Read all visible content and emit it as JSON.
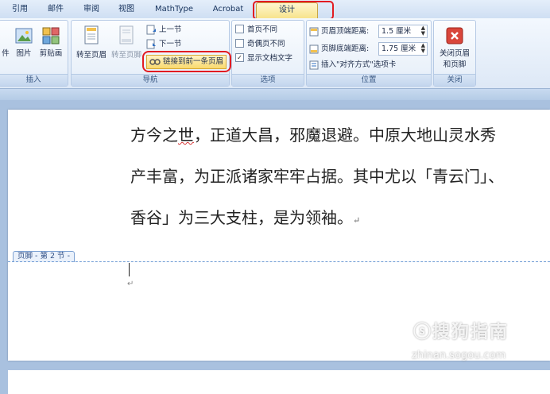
{
  "tabs": [
    {
      "label": "引用"
    },
    {
      "label": "邮件"
    },
    {
      "label": "审阅"
    },
    {
      "label": "视图"
    },
    {
      "label": "MathType"
    },
    {
      "label": "Acrobat"
    },
    {
      "label": "设计",
      "active": true
    }
  ],
  "ribbon": {
    "insert_group": {
      "name": "插入",
      "buttons": [
        "件",
        "图片",
        "剪贴画"
      ]
    },
    "nav_group": {
      "name": "导航",
      "goto_header": "转至页眉",
      "goto_footer": "转至页脚",
      "prev_section": "上一节",
      "next_section": "下一节",
      "link_previous": "链接到前一条页眉"
    },
    "options_group": {
      "name": "选项",
      "first_page_diff": "首页不同",
      "odd_even_diff": "奇偶页不同",
      "show_doc_text": "显示文档文字",
      "show_doc_text_checked": "✓"
    },
    "position_group": {
      "name": "位置",
      "header_top_label": "页眉顶端距离:",
      "header_top_value": "1.5 厘米",
      "footer_bottom_label": "页脚底端距离:",
      "footer_bottom_value": "1.75 厘米",
      "insert_align_tab": "插入\"对齐方式\"选项卡"
    },
    "close_group": {
      "name": "关闭",
      "close_label_1": "关闭页眉",
      "close_label_2": "和页脚"
    }
  },
  "document": {
    "line1_a": "方今之",
    "line1_b": "世",
    "line1_c": "，正道大昌，邪魔退避。中原大地山灵水秀",
    "line2": "产丰富，为正派诸家牢牢占据。其中尤以「青云门」、",
    "line3": "香谷」为三大支柱，是为领袖。",
    "para_mark": "↵",
    "footer_label": "页脚 - 第 2 节 -"
  },
  "watermark": {
    "text": "ⓢ搜狗指南",
    "url": "zhinan.sogou.com"
  },
  "colors": {
    "highlight": "#e21c22",
    "ribbon_bg": "#dde8f6",
    "workspace": "#a9c1df"
  }
}
